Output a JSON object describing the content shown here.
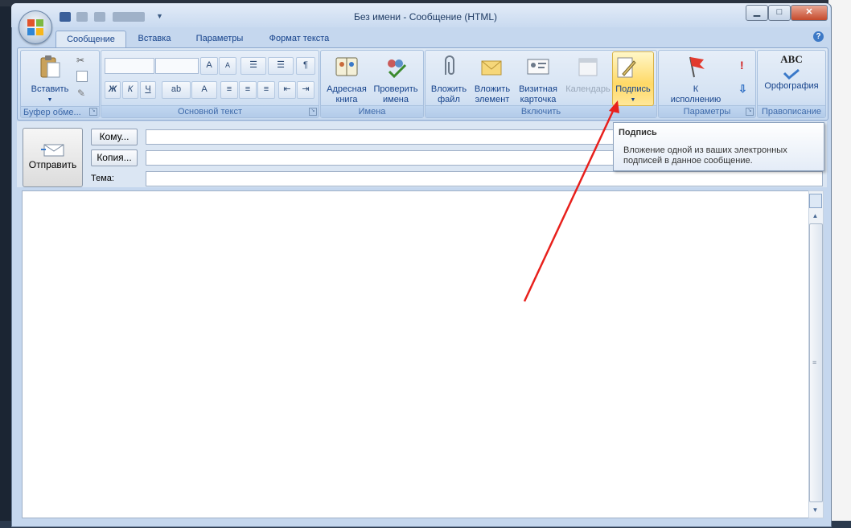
{
  "window": {
    "title": "Без имени - Сообщение (HTML)",
    "close_glyph": "✕",
    "min_glyph": "▁",
    "max_glyph": "□"
  },
  "tabs": [
    {
      "label": "Сообщение"
    },
    {
      "label": "Вставка"
    },
    {
      "label": "Параметры"
    },
    {
      "label": "Формат текста"
    }
  ],
  "ribbon": {
    "clipboard": {
      "group_label": "Буфер обме...",
      "paste_label": "Вставить"
    },
    "basic_text": {
      "group_label": "Основной текст",
      "bold": "Ж",
      "italic": "К",
      "underline": "Ч",
      "font_grow": "A",
      "font_shrink": "A",
      "highlight": "ab",
      "color": "A"
    },
    "names": {
      "group_label": "Имена",
      "address_book": [
        "Адресная",
        "книга"
      ],
      "check_names": [
        "Проверить",
        "имена"
      ]
    },
    "include": {
      "group_label": "Включить",
      "attach_file": [
        "Вложить",
        "файл"
      ],
      "attach_item": [
        "Вложить",
        "элемент"
      ],
      "business_card": [
        "Визитная",
        "карточка"
      ],
      "calendar": "Календарь",
      "signature": "Подпись"
    },
    "options": {
      "group_label": "Параметры",
      "follow_up": [
        "К",
        "исполнению"
      ],
      "high_importance": "!",
      "low_importance": "⇩"
    },
    "proofing": {
      "group_label": "Правописание",
      "spelling": "Орфография",
      "abc": "ABC"
    }
  },
  "form": {
    "send_label": "Отправить",
    "to_label": "Кому...",
    "cc_label": "Копия...",
    "subject_label": "Тема:",
    "to_value": "",
    "cc_value": "",
    "subject_value": ""
  },
  "tooltip": {
    "title": "Подпись",
    "text": "Вложение одной из ваших электронных подписей в данное сообщение."
  },
  "colors": {
    "accent": "#15428b",
    "highlight": "#ffd966",
    "arrow": "#e8201c"
  }
}
